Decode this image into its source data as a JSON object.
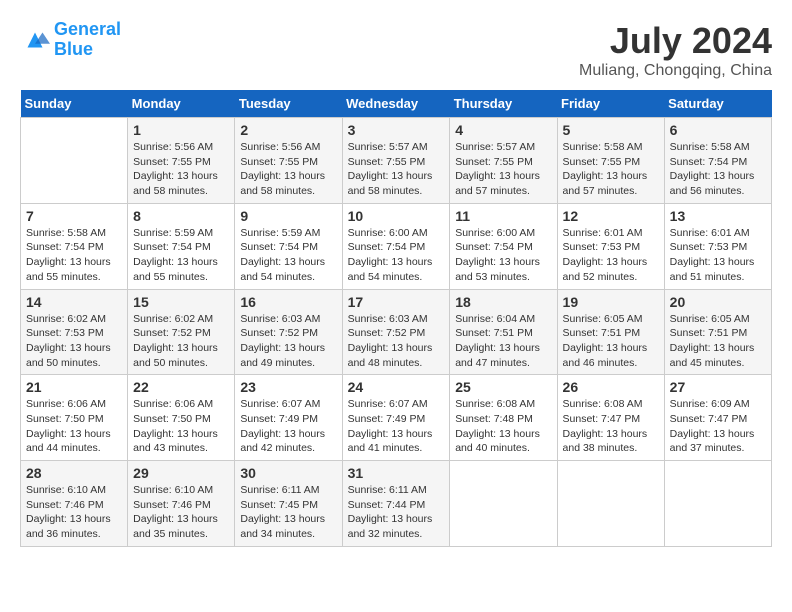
{
  "logo": {
    "line1": "General",
    "line2": "Blue"
  },
  "title": "July 2024",
  "subtitle": "Muliang, Chongqing, China",
  "weekdays": [
    "Sunday",
    "Monday",
    "Tuesday",
    "Wednesday",
    "Thursday",
    "Friday",
    "Saturday"
  ],
  "weeks": [
    [
      {
        "day": "",
        "sunrise": "",
        "sunset": "",
        "daylight": ""
      },
      {
        "day": "1",
        "sunrise": "Sunrise: 5:56 AM",
        "sunset": "Sunset: 7:55 PM",
        "daylight": "Daylight: 13 hours and 58 minutes."
      },
      {
        "day": "2",
        "sunrise": "Sunrise: 5:56 AM",
        "sunset": "Sunset: 7:55 PM",
        "daylight": "Daylight: 13 hours and 58 minutes."
      },
      {
        "day": "3",
        "sunrise": "Sunrise: 5:57 AM",
        "sunset": "Sunset: 7:55 PM",
        "daylight": "Daylight: 13 hours and 58 minutes."
      },
      {
        "day": "4",
        "sunrise": "Sunrise: 5:57 AM",
        "sunset": "Sunset: 7:55 PM",
        "daylight": "Daylight: 13 hours and 57 minutes."
      },
      {
        "day": "5",
        "sunrise": "Sunrise: 5:58 AM",
        "sunset": "Sunset: 7:55 PM",
        "daylight": "Daylight: 13 hours and 57 minutes."
      },
      {
        "day": "6",
        "sunrise": "Sunrise: 5:58 AM",
        "sunset": "Sunset: 7:54 PM",
        "daylight": "Daylight: 13 hours and 56 minutes."
      }
    ],
    [
      {
        "day": "7",
        "sunrise": "Sunrise: 5:58 AM",
        "sunset": "Sunset: 7:54 PM",
        "daylight": "Daylight: 13 hours and 55 minutes."
      },
      {
        "day": "8",
        "sunrise": "Sunrise: 5:59 AM",
        "sunset": "Sunset: 7:54 PM",
        "daylight": "Daylight: 13 hours and 55 minutes."
      },
      {
        "day": "9",
        "sunrise": "Sunrise: 5:59 AM",
        "sunset": "Sunset: 7:54 PM",
        "daylight": "Daylight: 13 hours and 54 minutes."
      },
      {
        "day": "10",
        "sunrise": "Sunrise: 6:00 AM",
        "sunset": "Sunset: 7:54 PM",
        "daylight": "Daylight: 13 hours and 54 minutes."
      },
      {
        "day": "11",
        "sunrise": "Sunrise: 6:00 AM",
        "sunset": "Sunset: 7:54 PM",
        "daylight": "Daylight: 13 hours and 53 minutes."
      },
      {
        "day": "12",
        "sunrise": "Sunrise: 6:01 AM",
        "sunset": "Sunset: 7:53 PM",
        "daylight": "Daylight: 13 hours and 52 minutes."
      },
      {
        "day": "13",
        "sunrise": "Sunrise: 6:01 AM",
        "sunset": "Sunset: 7:53 PM",
        "daylight": "Daylight: 13 hours and 51 minutes."
      }
    ],
    [
      {
        "day": "14",
        "sunrise": "Sunrise: 6:02 AM",
        "sunset": "Sunset: 7:53 PM",
        "daylight": "Daylight: 13 hours and 50 minutes."
      },
      {
        "day": "15",
        "sunrise": "Sunrise: 6:02 AM",
        "sunset": "Sunset: 7:52 PM",
        "daylight": "Daylight: 13 hours and 50 minutes."
      },
      {
        "day": "16",
        "sunrise": "Sunrise: 6:03 AM",
        "sunset": "Sunset: 7:52 PM",
        "daylight": "Daylight: 13 hours and 49 minutes."
      },
      {
        "day": "17",
        "sunrise": "Sunrise: 6:03 AM",
        "sunset": "Sunset: 7:52 PM",
        "daylight": "Daylight: 13 hours and 48 minutes."
      },
      {
        "day": "18",
        "sunrise": "Sunrise: 6:04 AM",
        "sunset": "Sunset: 7:51 PM",
        "daylight": "Daylight: 13 hours and 47 minutes."
      },
      {
        "day": "19",
        "sunrise": "Sunrise: 6:05 AM",
        "sunset": "Sunset: 7:51 PM",
        "daylight": "Daylight: 13 hours and 46 minutes."
      },
      {
        "day": "20",
        "sunrise": "Sunrise: 6:05 AM",
        "sunset": "Sunset: 7:51 PM",
        "daylight": "Daylight: 13 hours and 45 minutes."
      }
    ],
    [
      {
        "day": "21",
        "sunrise": "Sunrise: 6:06 AM",
        "sunset": "Sunset: 7:50 PM",
        "daylight": "Daylight: 13 hours and 44 minutes."
      },
      {
        "day": "22",
        "sunrise": "Sunrise: 6:06 AM",
        "sunset": "Sunset: 7:50 PM",
        "daylight": "Daylight: 13 hours and 43 minutes."
      },
      {
        "day": "23",
        "sunrise": "Sunrise: 6:07 AM",
        "sunset": "Sunset: 7:49 PM",
        "daylight": "Daylight: 13 hours and 42 minutes."
      },
      {
        "day": "24",
        "sunrise": "Sunrise: 6:07 AM",
        "sunset": "Sunset: 7:49 PM",
        "daylight": "Daylight: 13 hours and 41 minutes."
      },
      {
        "day": "25",
        "sunrise": "Sunrise: 6:08 AM",
        "sunset": "Sunset: 7:48 PM",
        "daylight": "Daylight: 13 hours and 40 minutes."
      },
      {
        "day": "26",
        "sunrise": "Sunrise: 6:08 AM",
        "sunset": "Sunset: 7:47 PM",
        "daylight": "Daylight: 13 hours and 38 minutes."
      },
      {
        "day": "27",
        "sunrise": "Sunrise: 6:09 AM",
        "sunset": "Sunset: 7:47 PM",
        "daylight": "Daylight: 13 hours and 37 minutes."
      }
    ],
    [
      {
        "day": "28",
        "sunrise": "Sunrise: 6:10 AM",
        "sunset": "Sunset: 7:46 PM",
        "daylight": "Daylight: 13 hours and 36 minutes."
      },
      {
        "day": "29",
        "sunrise": "Sunrise: 6:10 AM",
        "sunset": "Sunset: 7:46 PM",
        "daylight": "Daylight: 13 hours and 35 minutes."
      },
      {
        "day": "30",
        "sunrise": "Sunrise: 6:11 AM",
        "sunset": "Sunset: 7:45 PM",
        "daylight": "Daylight: 13 hours and 34 minutes."
      },
      {
        "day": "31",
        "sunrise": "Sunrise: 6:11 AM",
        "sunset": "Sunset: 7:44 PM",
        "daylight": "Daylight: 13 hours and 32 minutes."
      },
      {
        "day": "",
        "sunrise": "",
        "sunset": "",
        "daylight": ""
      },
      {
        "day": "",
        "sunrise": "",
        "sunset": "",
        "daylight": ""
      },
      {
        "day": "",
        "sunrise": "",
        "sunset": "",
        "daylight": ""
      }
    ]
  ]
}
